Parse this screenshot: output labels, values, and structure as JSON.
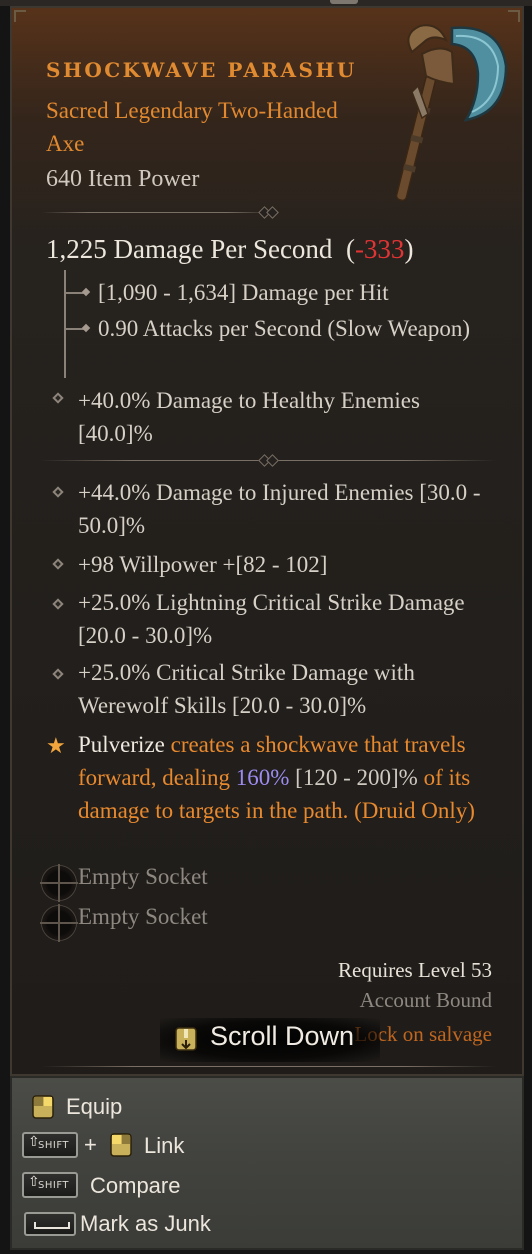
{
  "item": {
    "name": "SHOCKWAVE PARASHU",
    "type": "Sacred Legendary Two-Handed Axe",
    "item_power": "640 Item Power",
    "image_icon": "two-handed-axe-icon"
  },
  "stats": {
    "dps_label": "1,225 Damage Per Second",
    "dps_diff": "-333",
    "damage_per_hit": "[1,090 - 1,634] Damage per Hit",
    "attacks_per_second": "0.90 Attacks per Second (Slow Weapon)",
    "implicit": "+40.0% Damage to Healthy Enemies [40.0]%"
  },
  "affixes": [
    "+44.0% Damage to Injured Enemies [30.0 - 50.0]%",
    "+98 Willpower +[82 - 102]",
    "+25.0% Lightning Critical Strike Damage [20.0 - 30.0]%",
    "+25.0% Critical Strike Damage with Werewolf Skills [20.0 - 30.0]%"
  ],
  "aspect": {
    "skill": "Pulverize",
    "text_1": " creates a shockwave that travels forward, dealing ",
    "value": "160%",
    "range": " [120 - 200]%",
    "text_2": " of its damage to targets in the path. (Druid Only)"
  },
  "sockets": [
    "Empty Socket",
    "Empty Socket"
  ],
  "requirements": {
    "level": "Requires Level 53",
    "binding": "Account Bound",
    "salvage": "Lock on salvage"
  },
  "scroll_hint": "Scroll Down",
  "actions": {
    "equip": "Equip",
    "link": "Link",
    "compare": "Compare",
    "mark_junk": "Mark as Junk",
    "shift_key": "SHIFT",
    "plus": "+"
  }
}
